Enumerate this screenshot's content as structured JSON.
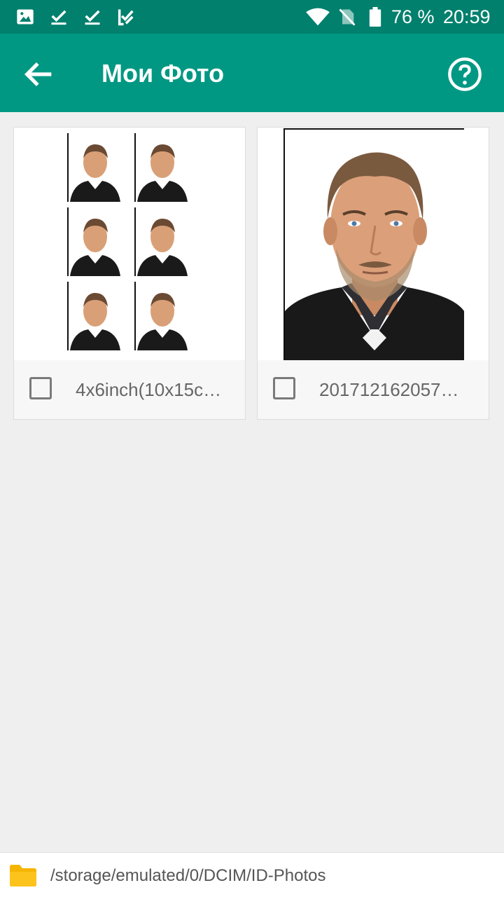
{
  "status_bar": {
    "icons": [
      "image-icon",
      "download-done-icon",
      "download-done-icon",
      "checklist-icon",
      "wifi-icon",
      "no-sim-icon",
      "battery-icon"
    ],
    "battery_percent": "76 %",
    "time": "20:59"
  },
  "app_bar": {
    "title": "Мои Фото",
    "back_icon": "arrow-back-icon",
    "help_icon": "help-circle-icon"
  },
  "photos": [
    {
      "file_name": "4x6inch(10x15c…",
      "checked": false,
      "thumbnail": "sheet-of-six-portrait-photos"
    },
    {
      "file_name": "201712162057…",
      "checked": false,
      "thumbnail": "single-portrait-photo"
    }
  ],
  "footer": {
    "folder_icon": "folder-icon",
    "path": "/storage/emulated/0/DCIM/ID-Photos"
  },
  "colors": {
    "status_bar": "#00806d",
    "app_bar": "#009883",
    "background": "#efefef",
    "folder": "#f5b400"
  }
}
